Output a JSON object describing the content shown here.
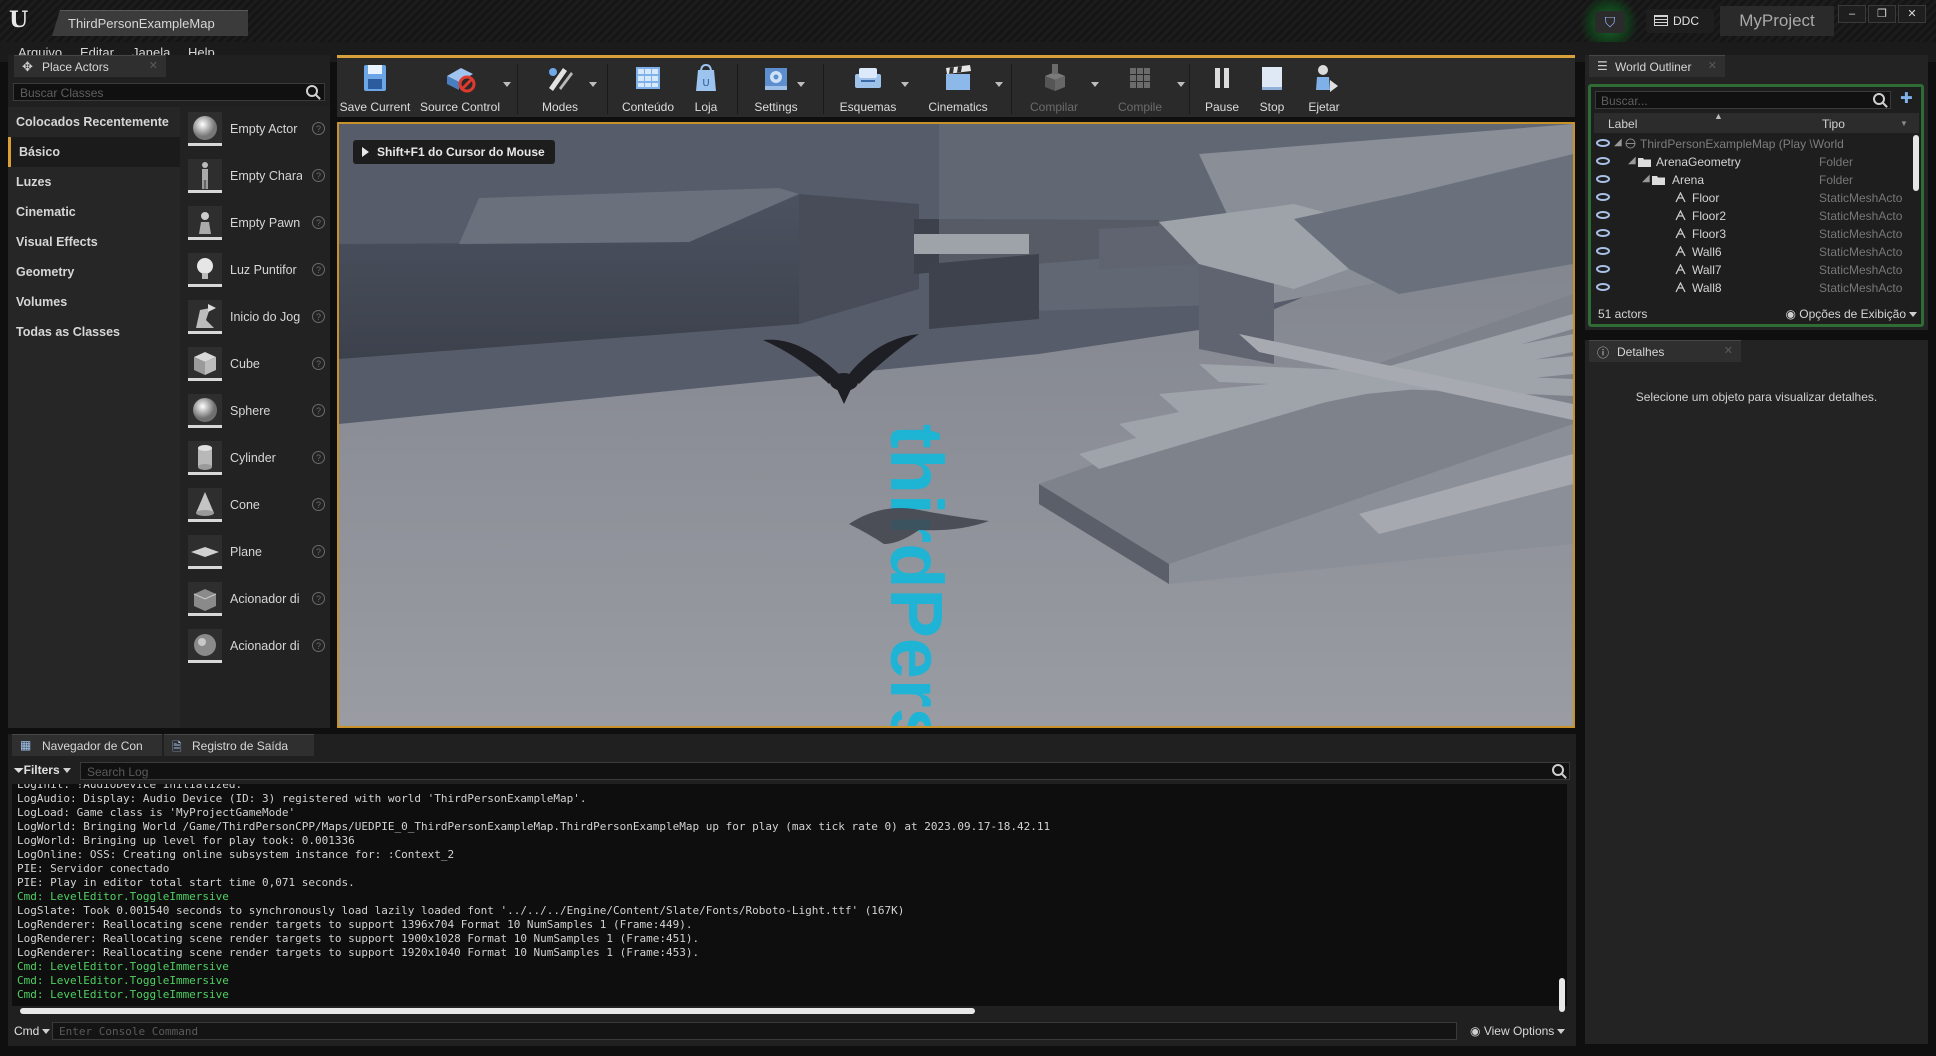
{
  "window": {
    "level_tab": "ThirdPersonExampleMap",
    "ddc_label": "DDC",
    "project_name": "MyProject",
    "minimize": "–",
    "restore": "❐",
    "close": "✕"
  },
  "menu": [
    "Arquivo",
    "Editar",
    "Janela",
    "Help"
  ],
  "place_actors": {
    "tab_label": "Place Actors",
    "search_placeholder": "Buscar Classes",
    "categories": [
      {
        "label": "Colocados Recentemente"
      },
      {
        "label": "Básico"
      },
      {
        "label": "Luzes"
      },
      {
        "label": "Cinematic"
      },
      {
        "label": "Visual Effects"
      },
      {
        "label": "Geometry"
      },
      {
        "label": "Volumes"
      },
      {
        "label": "Todas as Classes"
      }
    ],
    "active_category": "Básico",
    "items": [
      {
        "label": "Empty Actor",
        "icon": "sphere-icon"
      },
      {
        "label": "Empty Chara",
        "icon": "character-icon"
      },
      {
        "label": "Empty Pawn",
        "icon": "pawn-icon"
      },
      {
        "label": "Luz Puntifor",
        "icon": "point-light-icon"
      },
      {
        "label": "Inicio do Jog",
        "icon": "player-start-icon"
      },
      {
        "label": "Cube",
        "icon": "cube-icon"
      },
      {
        "label": "Sphere",
        "icon": "sphere-icon"
      },
      {
        "label": "Cylinder",
        "icon": "cylinder-icon"
      },
      {
        "label": "Cone",
        "icon": "cone-icon"
      },
      {
        "label": "Plane",
        "icon": "plane-icon"
      },
      {
        "label": "Acionador di",
        "icon": "trigger-box-icon"
      },
      {
        "label": "Acionador di",
        "icon": "trigger-sphere-icon"
      }
    ]
  },
  "toolbar": {
    "buttons": [
      {
        "label": "Save Current",
        "icon": "save-icon",
        "enabled": true
      },
      {
        "label": "Source Control",
        "icon": "source-control-icon",
        "enabled": true
      },
      {
        "label": "Modes",
        "icon": "modes-icon",
        "enabled": true
      },
      {
        "label": "Conteúdo",
        "icon": "content-icon",
        "enabled": true
      },
      {
        "label": "Loja",
        "icon": "marketplace-icon",
        "enabled": true
      },
      {
        "label": "Settings",
        "icon": "settings-icon",
        "enabled": true
      },
      {
        "label": "Esquemas",
        "icon": "blueprints-icon",
        "enabled": true
      },
      {
        "label": "Cinematics",
        "icon": "cinematics-icon",
        "enabled": true
      },
      {
        "label": "Compilar",
        "icon": "build-icon",
        "enabled": false
      },
      {
        "label": "Compile",
        "icon": "compile-icon",
        "enabled": false
      },
      {
        "label": "Pause",
        "icon": "pause-icon",
        "enabled": true
      },
      {
        "label": "Stop",
        "icon": "stop-icon",
        "enabled": true
      },
      {
        "label": "Ejetar",
        "icon": "eject-icon",
        "enabled": true
      }
    ]
  },
  "viewport": {
    "hint": "Shift+F1 do Cursor do Mouse",
    "floor_text": "thirdPerson"
  },
  "outliner": {
    "tab_label": "World Outliner",
    "search_placeholder": "Buscar...",
    "col_label": "Label",
    "col_type": "Tipo",
    "rows": [
      {
        "label": "ThirdPersonExampleMap (Play \\World",
        "type": "",
        "icon": "world-icon"
      },
      {
        "label": "ArenaGeometry",
        "type": "Folder",
        "icon": "folder-icon"
      },
      {
        "label": "Arena",
        "type": "Folder",
        "icon": "folder-icon"
      },
      {
        "label": "Floor",
        "type": "StaticMeshActo",
        "icon": "static-mesh-icon"
      },
      {
        "label": "Floor2",
        "type": "StaticMeshActo",
        "icon": "static-mesh-icon"
      },
      {
        "label": "Floor3",
        "type": "StaticMeshActo",
        "icon": "static-mesh-icon"
      },
      {
        "label": "Wall6",
        "type": "StaticMeshActo",
        "icon": "static-mesh-icon"
      },
      {
        "label": "Wall7",
        "type": "StaticMeshActo",
        "icon": "static-mesh-icon"
      },
      {
        "label": "Wall8",
        "type": "StaticMeshActo",
        "icon": "static-mesh-icon"
      }
    ],
    "actor_count": "51 actors",
    "view_options": "Opções de Exibição"
  },
  "details": {
    "tab_label": "Detalhes",
    "empty_message": "Selecione um objeto para visualizar detalhes."
  },
  "log": {
    "tabs": [
      "Navegador de Con",
      "Registro de Saída"
    ],
    "filters_label": "Filters",
    "search_placeholder": "Search Log",
    "lines": [
      {
        "text": "LogInit: !AudioDevice initialized.",
        "kind": "normal"
      },
      {
        "text": "LogAudio: Display: Audio Device (ID: 3) registered with world 'ThirdPersonExampleMap'.",
        "kind": "normal"
      },
      {
        "text": "LogLoad: Game class is 'MyProjectGameMode'",
        "kind": "normal"
      },
      {
        "text": "LogWorld: Bringing World /Game/ThirdPersonCPP/Maps/UEDPIE_0_ThirdPersonExampleMap.ThirdPersonExampleMap up for play (max tick rate 0) at 2023.09.17-18.42.11",
        "kind": "normal"
      },
      {
        "text": "LogWorld: Bringing up level for play took: 0.001336",
        "kind": "normal"
      },
      {
        "text": "LogOnline: OSS: Creating online subsystem instance for: :Context_2",
        "kind": "normal"
      },
      {
        "text": "PIE: Servidor conectado",
        "kind": "normal"
      },
      {
        "text": "PIE: Play in editor total start time 0,071 seconds.",
        "kind": "normal"
      },
      {
        "text": "Cmd: LevelEditor.ToggleImmersive",
        "kind": "cmd"
      },
      {
        "text": "LogSlate: Took 0.001540 seconds to synchronously load lazily loaded font '../../../Engine/Content/Slate/Fonts/Roboto-Light.ttf' (167K)",
        "kind": "normal"
      },
      {
        "text": "LogRenderer: Reallocating scene render targets to support 1396x704 Format 10 NumSamples 1 (Frame:449).",
        "kind": "normal"
      },
      {
        "text": "LogRenderer: Reallocating scene render targets to support 1900x1028 Format 10 NumSamples 1 (Frame:451).",
        "kind": "normal"
      },
      {
        "text": "LogRenderer: Reallocating scene render targets to support 1920x1040 Format 10 NumSamples 1 (Frame:453).",
        "kind": "normal"
      },
      {
        "text": "Cmd: LevelEditor.ToggleImmersive",
        "kind": "cmd"
      },
      {
        "text": "Cmd: LevelEditor.ToggleImmersive",
        "kind": "cmd"
      },
      {
        "text": "Cmd: LevelEditor.ToggleImmersive",
        "kind": "cmd"
      }
    ],
    "cmd_label": "Cmd",
    "cmd_placeholder": "Enter Console Command",
    "view_options": "View Options"
  },
  "colors": {
    "accent_orange": "#d8a23a",
    "outliner_green": "#2e6b35",
    "cmd_green": "#4fd062",
    "floor_text": "#19b6d8"
  }
}
